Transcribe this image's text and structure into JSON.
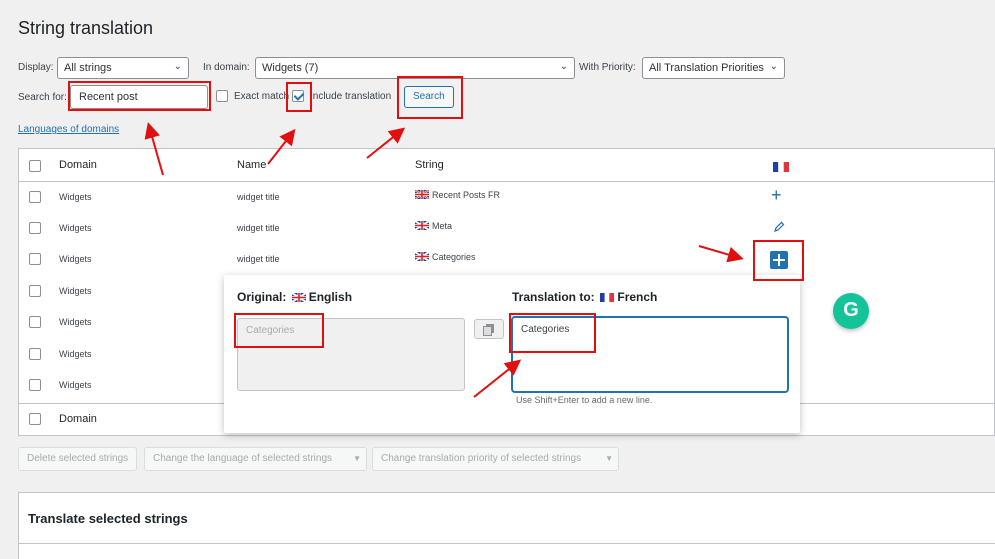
{
  "page": {
    "title": "String translation"
  },
  "filters": {
    "display_label": "Display:",
    "display_value": "All strings",
    "domain_label": "In domain:",
    "domain_value": "Widgets (7)",
    "priority_label": "With Priority:",
    "priority_value": "All Translation Priorities",
    "search_label": "Search for:",
    "search_value": "Recent post",
    "exact_match_label": "Exact match",
    "include_translation_label": "Include translation",
    "search_button": "Search",
    "languages_link": "Languages of domains"
  },
  "table": {
    "headers": {
      "domain": "Domain",
      "name": "Name",
      "string": "String"
    },
    "footer_domain": "Domain",
    "rows": [
      {
        "domain": "Widgets",
        "name": "widget title",
        "string": "Recent Posts FR",
        "action": "add"
      },
      {
        "domain": "Widgets",
        "name": "widget title",
        "string": "Meta",
        "action": "edit"
      },
      {
        "domain": "Widgets",
        "name": "widget title",
        "string": "Categories",
        "action": "add-active"
      },
      {
        "domain": "Widgets"
      },
      {
        "domain": "Widgets"
      },
      {
        "domain": "Widgets"
      },
      {
        "domain": "Widgets"
      }
    ]
  },
  "popup": {
    "original_label": "Original:",
    "original_lang": "English",
    "original_text": "Categories",
    "translation_label": "Translation to:",
    "translation_lang": "French",
    "translation_text": "Categories",
    "hint": "Use Shift+Enter to add a new line."
  },
  "bulk_actions": {
    "delete": "Delete selected strings",
    "change_language": "Change the language of selected strings",
    "change_priority": "Change translation priority of selected strings"
  },
  "translate_panel": {
    "title": "Translate selected strings"
  },
  "icons": {
    "grammarly": "grammarly-icon",
    "add": "plus-icon",
    "edit": "pencil-icon",
    "copy": "copy-icon"
  },
  "colors": {
    "accent": "#2271b1",
    "annotation": "#e01010",
    "grammarly": "#15c39a"
  }
}
